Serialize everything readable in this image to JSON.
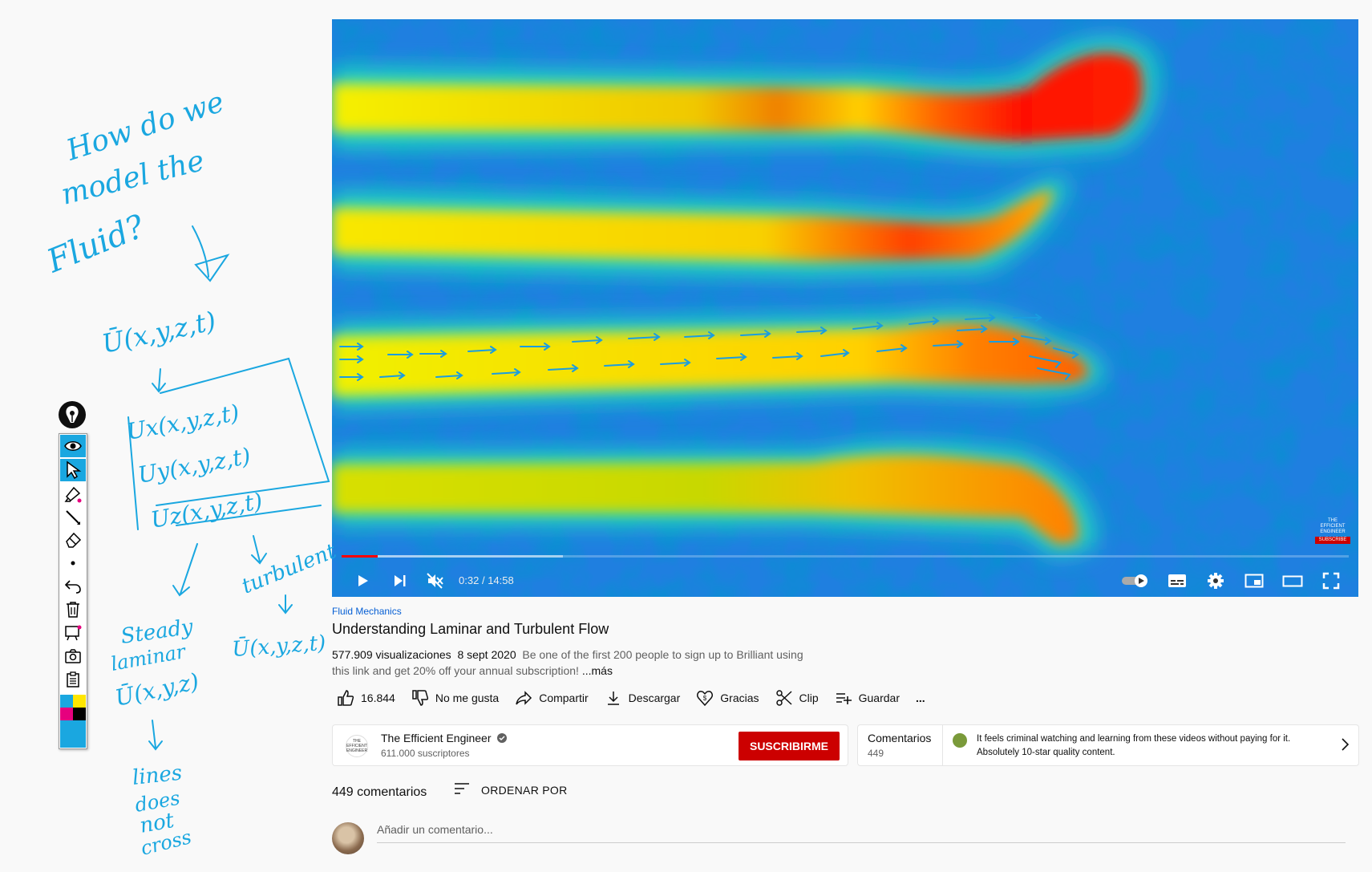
{
  "video": {
    "time_current": "0:32",
    "time_separator": "/",
    "time_total": "14:58",
    "progress_fraction": 0.036,
    "buffered_fraction": 0.22,
    "watermark_line1": "THE",
    "watermark_line2": "EFFICIENT",
    "watermark_line3": "ENGINEER",
    "watermark_subscribe": "SUBSCRIBE",
    "controls": [
      "play-icon",
      "next-icon",
      "mute-icon",
      "autoplay-toggle-icon",
      "subtitles-icon",
      "settings-icon",
      "miniplayer-icon",
      "theater-icon",
      "fullscreen-icon"
    ]
  },
  "meta": {
    "category": "Fluid Mechanics",
    "title": "Understanding Laminar and Turbulent Flow",
    "views": "577.909 visualizaciones",
    "date": "8 sept 2020",
    "description_line1": "Be one of the first 200 people to sign up to Brilliant using",
    "description_line2": "this link and get 20% off your annual subscription!",
    "more": "...más"
  },
  "actions": {
    "like_count": "16.844",
    "dislike": "No me gusta",
    "share": "Compartir",
    "download": "Descargar",
    "thanks": "Gracias",
    "clip": "Clip",
    "save": "Guardar",
    "more": "..."
  },
  "channel": {
    "avatar_text": "THE EFFICIENT ENGINEER",
    "name": "The Efficient Engineer",
    "subscribers": "611.000 suscriptores",
    "subscribe": "SUSCRIBIRME"
  },
  "comments_card": {
    "title": "Comentarios",
    "count": "449",
    "top_comment": "It feels criminal watching and learning from these videos without paying for it. Absolutely 10-star quality content."
  },
  "comments": {
    "count_label": "449 comentarios",
    "sort_label": "ORDENAR POR",
    "placeholder": "Añadir un comentario..."
  },
  "toolbar": {
    "tools": [
      "view-icon",
      "pointer-icon",
      "highlighter-icon",
      "line-icon",
      "eraser-icon",
      "dot-icon",
      "undo-icon",
      "trash-icon",
      "whiteboard-icon",
      "camera-icon",
      "clipboard-icon"
    ],
    "palette": [
      "#1aa7e0",
      "#ffe600",
      "#e6007e",
      "#000000",
      "#1aa7e0",
      "#1aa7e0"
    ]
  },
  "annotations": {
    "line1": "How do we",
    "line2": "model the",
    "line3": "Fluid?",
    "vector": "Ū(x,y,z,t)",
    "ux": "Ux(x,y,z,t)",
    "uy": "Uy(x,y,z,t)",
    "uz": "Uz(x,y,z,t)",
    "steady": "Steady",
    "laminar": "laminar",
    "steady_eq": "Ū(x,y,z)",
    "turbulent": "turbulent",
    "turbulent_eq": "Ū(x,y,z,t)",
    "lines1": "lines",
    "lines2": "does",
    "lines3": "not",
    "lines4": "cross"
  }
}
